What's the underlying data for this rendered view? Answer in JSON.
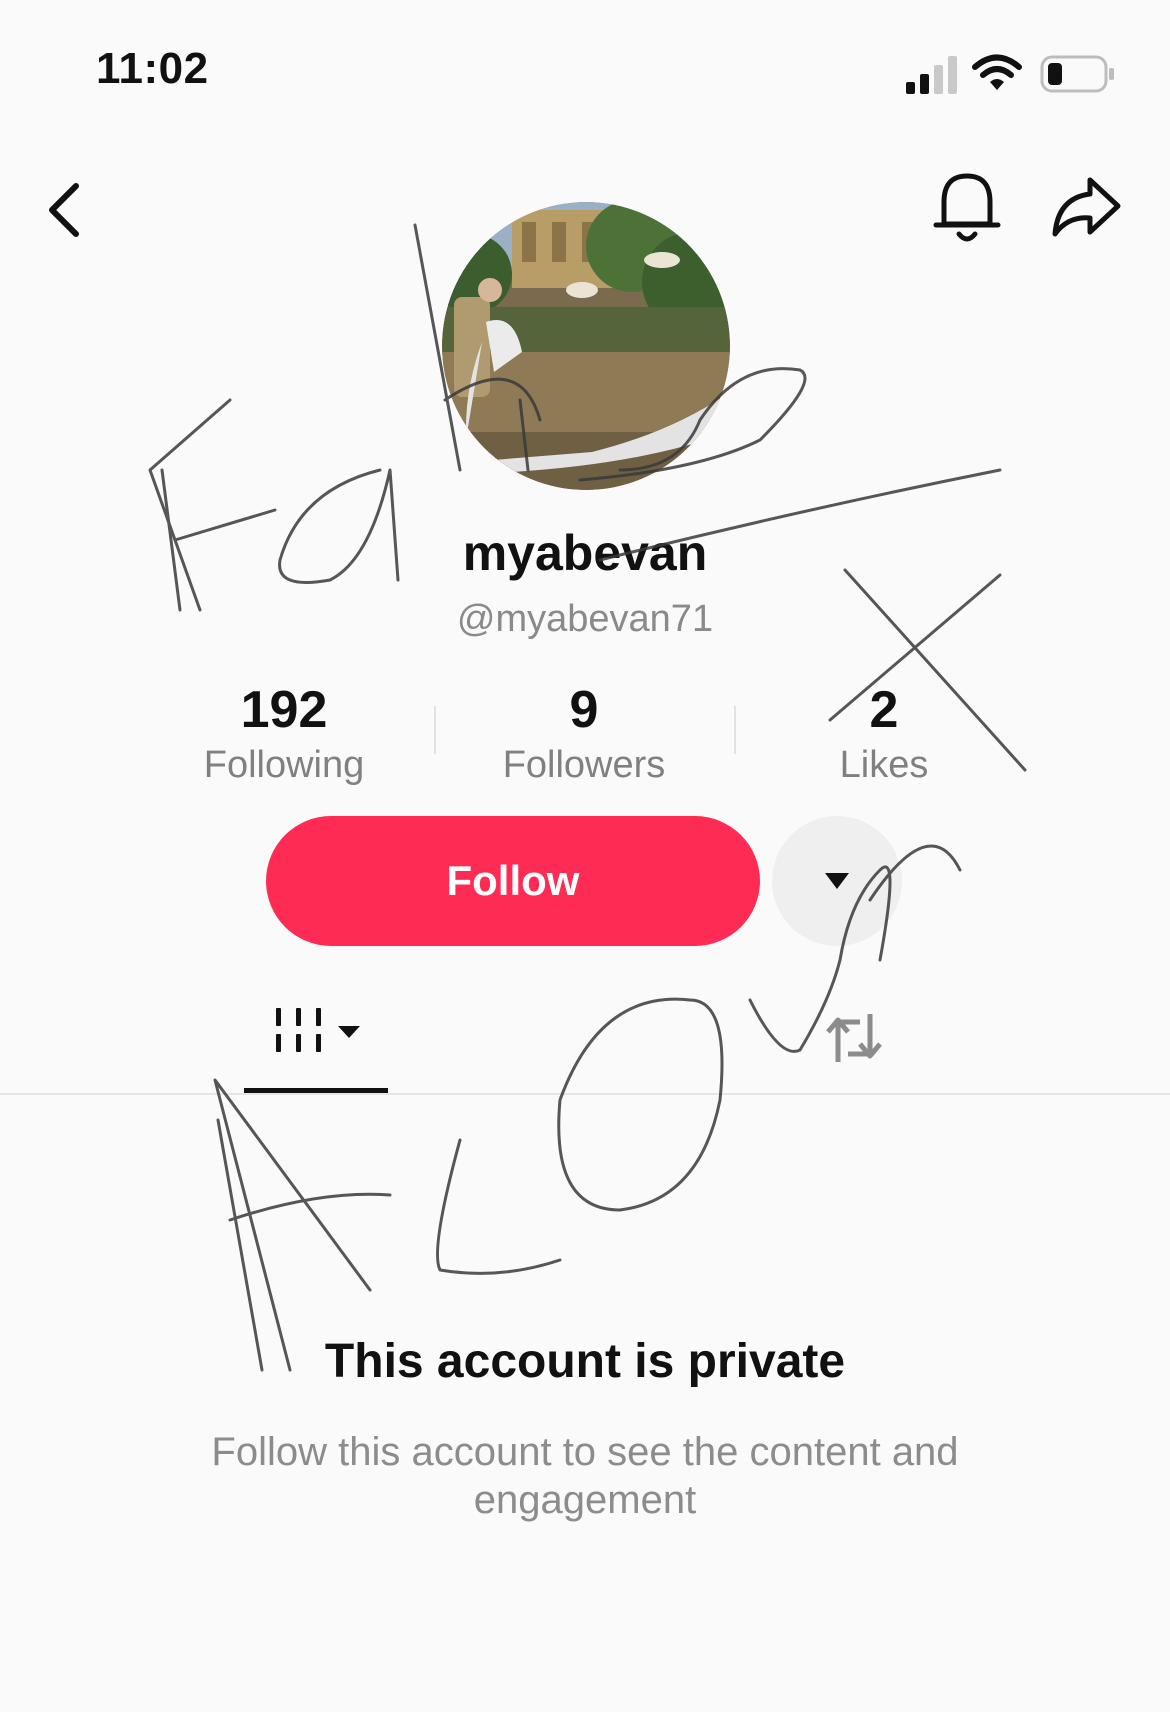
{
  "status_bar": {
    "time": "11:02",
    "icons": [
      "cellular-signal-icon",
      "wifi-icon",
      "battery-icon"
    ]
  },
  "nav": {
    "icons": [
      "back-icon",
      "bell-icon",
      "share-icon"
    ]
  },
  "profile": {
    "display_name": "myabevan",
    "handle": "@myabevan71",
    "avatar": "wedding photo of couple on lawn"
  },
  "stats": [
    {
      "value": "192",
      "label": "Following"
    },
    {
      "value": "9",
      "label": "Followers"
    },
    {
      "value": "2",
      "label": "Likes"
    }
  ],
  "actions": {
    "follow_label": "Follow",
    "accent_color": "#fe2c55",
    "more_icon": "caret-down-icon"
  },
  "tabs": {
    "items": [
      "videos-grid-icon",
      "repost-icon"
    ],
    "selected": "videos-grid-icon"
  },
  "private": {
    "title": "This account is private",
    "description": "Follow this account to see the content and engagement"
  },
  "annotation": {
    "handwritten_text": "Fake Acount"
  }
}
